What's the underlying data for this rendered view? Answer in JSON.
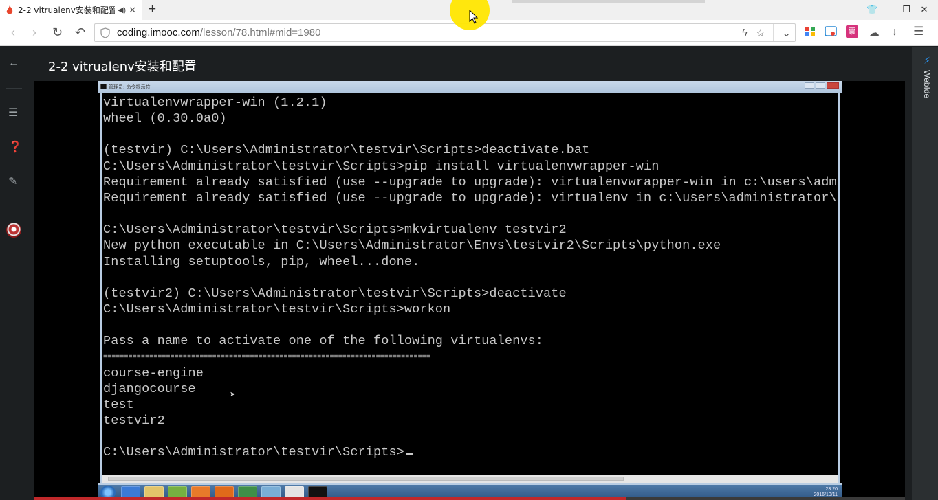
{
  "browser": {
    "tab_title": "2-2 vitrualenv安装和配置",
    "new_tab_symbol": "+",
    "address": {
      "host": "coding.imooc.com",
      "path": "/lesson/78.html#mid=1980"
    },
    "icons": [
      "back-icon",
      "forward-icon",
      "reload-icon",
      "undo-icon",
      "shield-icon",
      "bolt-icon",
      "star-icon",
      "dropdown-icon",
      "apps-icon",
      "cut-icon",
      "ticket-icon",
      "cloud-icon",
      "download-icon",
      "menu-icon"
    ],
    "ticket_label": "票"
  },
  "page": {
    "lesson_title": "2-2 vitrualenv安装和配置",
    "right_panel_label": "WebIde",
    "video_progress": 0.68,
    "brand_color": "#c0282a"
  },
  "cmd": {
    "window_title": "管理员: 命令提示符",
    "lines": [
      "virtualenvwrapper-win (1.2.1)",
      "wheel (0.30.0a0)",
      "",
      "(testvir) C:\\Users\\Administrator\\testvir\\Scripts>deactivate.bat",
      "C:\\Users\\Administrator\\testvir\\Scripts>pip install virtualenvwrapper-win",
      "Requirement already satisfied (use --upgrade to upgrade): virtualenvwrapper-win in c:\\users\\administrator\\",
      "Requirement already satisfied (use --upgrade to upgrade): virtualenv in c:\\users\\administrator\\testvir\\lib",
      "",
      "C:\\Users\\Administrator\\testvir\\Scripts>mkvirtualenv testvir2",
      "New python executable in C:\\Users\\Administrator\\Envs\\testvir2\\Scripts\\python.exe",
      "Installing setuptools, pip, wheel...done.",
      "",
      "(testvir2) C:\\Users\\Administrator\\testvir\\Scripts>deactivate",
      "C:\\Users\\Administrator\\testvir\\Scripts>workon",
      "",
      "Pass a name to activate one of the following virtualenvs:",
      "==============================================================================",
      "course-engine",
      "djangocourse",
      "test",
      "testvir2",
      "",
      "C:\\Users\\Administrator\\testvir\\Scripts>"
    ],
    "clock": {
      "time": "23:20",
      "date": "2016/10/11"
    }
  }
}
